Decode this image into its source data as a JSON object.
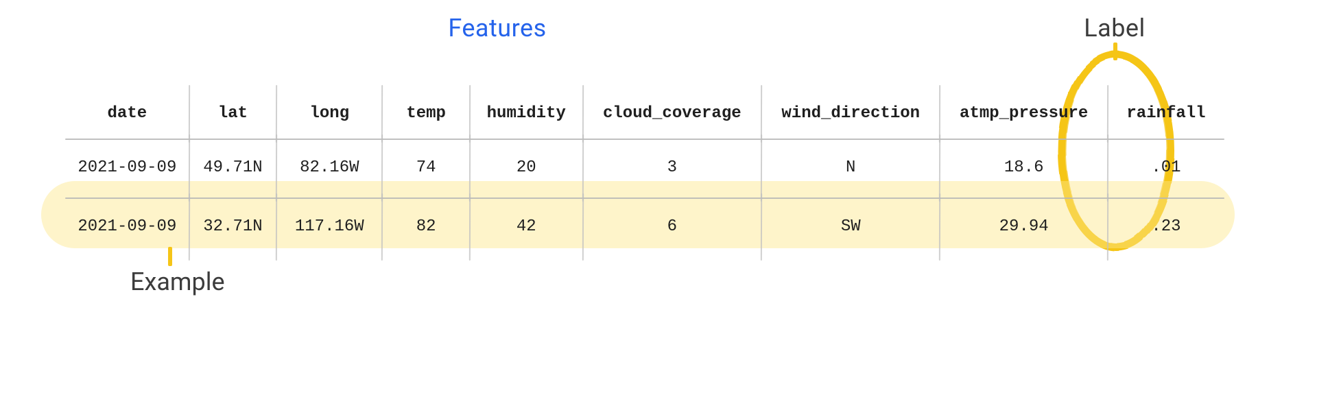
{
  "annotations": {
    "features": "Features",
    "label": "Label",
    "example": "Example"
  },
  "table": {
    "headers": {
      "date": "date",
      "lat": "lat",
      "long": "long",
      "temp": "temp",
      "humidity": "humidity",
      "cloud_coverage": "cloud_coverage",
      "wind_direction": "wind_direction",
      "atmp_pressure": "atmp_pressure",
      "rainfall": "rainfall"
    },
    "rows": [
      {
        "date": "2021-09-09",
        "lat": "49.71N",
        "long": "82.16W",
        "temp": "74",
        "humidity": "20",
        "cloud_coverage": "3",
        "wind_direction": "N",
        "atmp_pressure": "18.6",
        "rainfall": ".01"
      },
      {
        "date": "2021-09-09",
        "lat": "32.71N",
        "long": "117.16W",
        "temp": "82",
        "humidity": "42",
        "cloud_coverage": "6",
        "wind_direction": "SW",
        "atmp_pressure": "29.94",
        "rainfall": ".23"
      }
    ]
  },
  "colors": {
    "features_accent": "#2563eb",
    "label_accent": "#f5c518",
    "highlight_row": "#fde68a"
  }
}
